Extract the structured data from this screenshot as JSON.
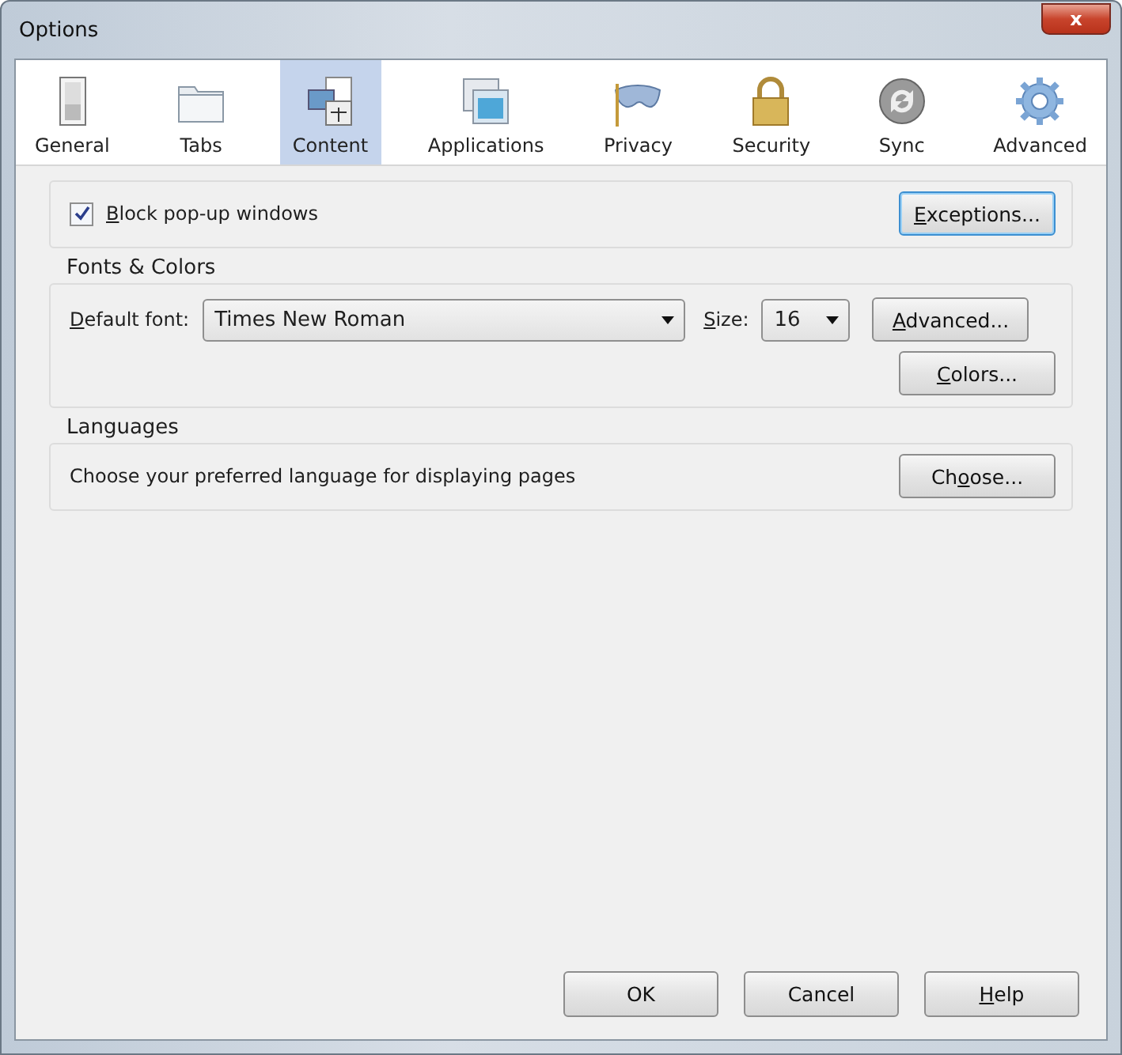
{
  "window": {
    "title": "Options",
    "close_label": "x"
  },
  "tabs": [
    {
      "label": "General",
      "kind": "general",
      "selected": false
    },
    {
      "label": "Tabs",
      "kind": "tabs",
      "selected": false
    },
    {
      "label": "Content",
      "kind": "content",
      "selected": true
    },
    {
      "label": "Applications",
      "kind": "applications",
      "selected": false
    },
    {
      "label": "Privacy",
      "kind": "privacy",
      "selected": false
    },
    {
      "label": "Security",
      "kind": "security",
      "selected": false
    },
    {
      "label": "Sync",
      "kind": "sync",
      "selected": false
    },
    {
      "label": "Advanced",
      "kind": "advanced",
      "selected": false
    }
  ],
  "popups": {
    "label": [
      {
        "text": "B",
        "underline": true
      },
      {
        "text": "lock pop-up windows"
      }
    ],
    "checked": true,
    "button": {
      "label": [
        {
          "text": "E",
          "underline": true
        },
        {
          "text": "xceptions..."
        }
      ],
      "focused": true
    }
  },
  "fonts": {
    "title": "Fonts & Colors",
    "font_label": [
      {
        "text": "D",
        "underline": true
      },
      {
        "text": "efault font:"
      }
    ],
    "font_value": "Times New Roman",
    "size_label": [
      {
        "text": "S",
        "underline": true
      },
      {
        "text": "ize:"
      }
    ],
    "size_value": "16",
    "advanced_button": {
      "label": [
        {
          "text": "A",
          "underline": true
        },
        {
          "text": "dvanced..."
        }
      ],
      "focused": false
    },
    "colors_button": {
      "label": [
        {
          "text": "C",
          "underline": true
        },
        {
          "text": "olors..."
        }
      ],
      "focused": false
    }
  },
  "languages": {
    "title": "Languages",
    "text": "Choose your preferred language for displaying pages",
    "button": {
      "label": [
        {
          "text": "Ch"
        },
        {
          "text": "o",
          "underline": true
        },
        {
          "text": "ose..."
        }
      ],
      "focused": false
    }
  },
  "footer_buttons": [
    {
      "label": [
        {
          "text": "OK"
        }
      ],
      "focused": false
    },
    {
      "label": [
        {
          "text": "Cancel"
        }
      ],
      "focused": false
    },
    {
      "label": [
        {
          "text": "H",
          "underline": true
        },
        {
          "text": "elp"
        }
      ],
      "focused": false
    }
  ]
}
